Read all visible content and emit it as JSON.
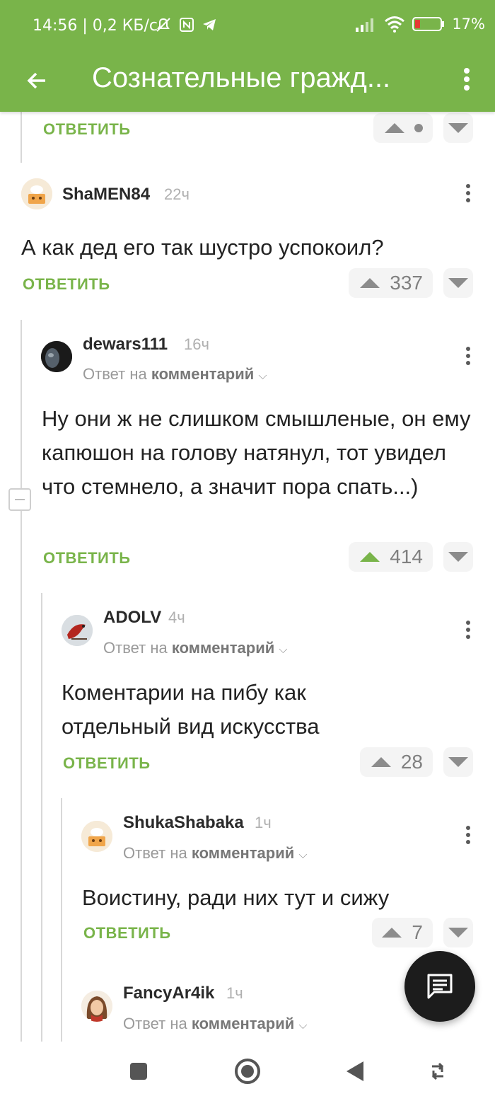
{
  "status": {
    "time_speed": "14:56 | 0,2 КБ/с",
    "battery": "17%"
  },
  "appbar": {
    "title": "Сознательные гражд..."
  },
  "top_partial": {
    "reply_label": "ОТВЕТИТЬ"
  },
  "comments": [
    {
      "user": "ShaMEN84",
      "time": "22ч",
      "text": "А как дед его так шустро успокоил?",
      "reply_label": "ОТВЕТИТЬ",
      "votes": "337"
    },
    {
      "user": "dewars111",
      "time": "16ч",
      "reply_prefix": "Ответ на",
      "reply_target": "комментарий",
      "text": "Ну они ж не слишком смышленые, он ему капюшон на голову натянул, тот увидел что стемнело, а значит пора спать...)",
      "reply_label": "ОТВЕТИТЬ",
      "votes": "414"
    },
    {
      "user": "ADOLV",
      "time": "4ч",
      "reply_prefix": "Ответ на",
      "reply_target": "комментарий",
      "text": "Коментарии на пибу как отдельный вид искусства",
      "reply_label": "ОТВЕТИТЬ",
      "votes": "28"
    },
    {
      "user": "ShukaShabaka",
      "time": "1ч",
      "reply_prefix": "Ответ на",
      "reply_target": "комментарий",
      "text": "Воистину, ради них тут и сижу",
      "reply_label": "ОТВЕТИТЬ",
      "votes": "7"
    },
    {
      "user": "FancyAr4ik",
      "time": "1ч",
      "reply_prefix": "Ответ на",
      "reply_target": "комментарий"
    }
  ],
  "colors": {
    "accent": "#79b44a",
    "upvote_active": "#79b44a"
  },
  "icons": [
    "back-arrow-icon",
    "more-vert-icon",
    "chat-icon",
    "nav-square-icon",
    "nav-circle-icon",
    "nav-back-icon",
    "rotate-icon",
    "wifi-icon",
    "signal-icon",
    "battery-icon"
  ]
}
